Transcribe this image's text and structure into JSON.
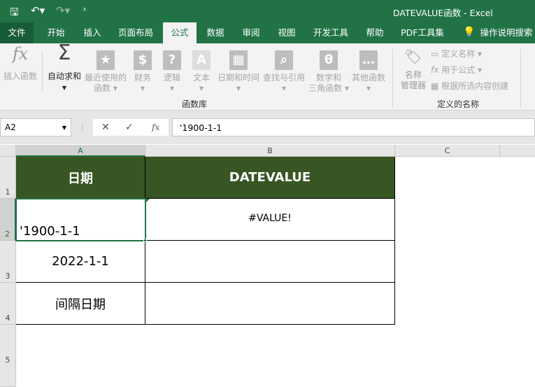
{
  "title": "DATEVALUE函数 - Excel",
  "tabs": [
    "文件",
    "开始",
    "插入",
    "页面布局",
    "公式",
    "数据",
    "审阅",
    "视图",
    "开发工具",
    "帮助",
    "PDF工具集"
  ],
  "active_tab": "公式",
  "tell_me": "操作说明搜索",
  "ribbon": {
    "insert_function": "插入函数",
    "autosum": "自动求和",
    "recent_1": "最近使用的",
    "recent_2": "函数",
    "financial": "财务",
    "logical": "逻辑",
    "text": "文本",
    "datetime": "日期和时间",
    "lookup": "查找与引用",
    "math_1": "数学和",
    "math_2": "三角函数",
    "more": "其他函数",
    "group_library": "函数库",
    "name_mgr_1": "名称",
    "name_mgr_2": "管理器",
    "define_name": "定义名称",
    "use_in_formula": "用于公式",
    "create_from_sel": "根据所选内容创建",
    "group_names": "定义的名称"
  },
  "formula_bar": {
    "name_box": "A2",
    "fx": "fx",
    "value": "'1900-1-1"
  },
  "columns": [
    "A",
    "B",
    "C"
  ],
  "rows": [
    "1",
    "2",
    "3",
    "4",
    "5"
  ],
  "cells": {
    "A1": "日期",
    "B1": "DATEVALUE",
    "A2": "'1900-1-1",
    "B2": "#VALUE!",
    "A3": "2022-1-1",
    "A4": "间隔日期"
  }
}
